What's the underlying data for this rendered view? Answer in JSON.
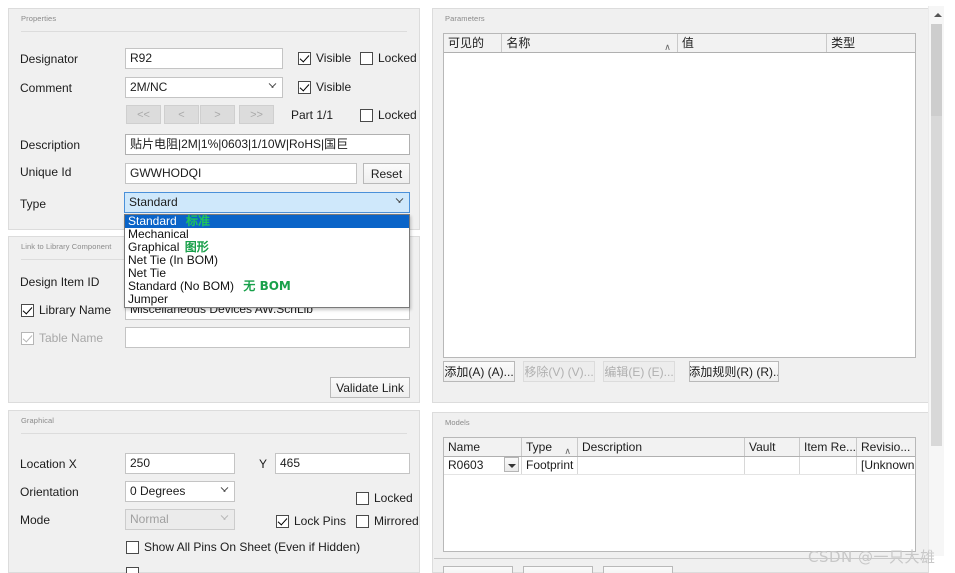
{
  "panels": {
    "properties": {
      "title": "Properties"
    },
    "link_library": {
      "title": "Link to Library Component"
    },
    "graphical": {
      "title": "Graphical"
    },
    "parameters": {
      "title": "Parameters"
    },
    "models": {
      "title": "Models"
    }
  },
  "properties": {
    "designator": {
      "label": "Designator",
      "value": "R92",
      "visible_label": "Visible",
      "locked_label": "Locked"
    },
    "comment": {
      "label": "Comment",
      "value": "2M/NC",
      "visible_label": "Visible"
    },
    "part_nav": {
      "first_label": "<<",
      "prev_label": "<",
      "next_label": ">",
      "last_label": ">>",
      "part_label": "Part 1/1",
      "locked_label": "Locked"
    },
    "description": {
      "label": "Description",
      "value": "贴片电阻|2M|1%|0603|1/10W|RoHS|国巨"
    },
    "unique_id": {
      "label": "Unique Id",
      "value": "GWWHODQI",
      "reset_label": "Reset"
    },
    "type": {
      "label": "Type",
      "value": "Standard",
      "options": [
        {
          "label": "Standard",
          "note": "标准",
          "selected": true
        },
        {
          "label": "Mechanical",
          "note": "",
          "selected": false
        },
        {
          "label": "Graphical",
          "note": "图形",
          "selected": false
        },
        {
          "label": "Net Tie (In BOM)",
          "note": "",
          "selected": false
        },
        {
          "label": "Net Tie",
          "note": "",
          "selected": false
        },
        {
          "label": "Standard (No BOM)",
          "note": "无 BOM",
          "selected": false
        },
        {
          "label": "Jumper",
          "note": "",
          "selected": false
        }
      ]
    }
  },
  "link_library": {
    "design_item_id": {
      "label": "Design Item ID",
      "value": ""
    },
    "library_name": {
      "label": "Library Name",
      "value": "Miscellaneous Devices AW.SchLib"
    },
    "table_name": {
      "label": "Table Name",
      "value": ""
    },
    "validate_link_label": "Validate Link"
  },
  "graphical": {
    "location": {
      "label_x": "Location  X",
      "value_x": "250",
      "label_y": "Y",
      "value_y": "465"
    },
    "orientation": {
      "label": "Orientation",
      "value": "0 Degrees"
    },
    "mode": {
      "label": "Mode",
      "value": "Normal"
    },
    "locked_label": "Locked",
    "lock_pins_label": "Lock Pins",
    "mirrored_label": "Mirrored",
    "show_all_pins_label": "Show All Pins On Sheet (Even if Hidden)"
  },
  "parameters": {
    "columns": [
      "可见的",
      "名称",
      "值",
      "类型"
    ],
    "sort_column_index": 1,
    "sort_mark": "∧",
    "rows": [],
    "buttons": [
      {
        "label": "添加(A) (A)...",
        "enabled": true
      },
      {
        "label": "移除(V) (V)...",
        "enabled": false
      },
      {
        "label": "编辑(E) (E)...",
        "enabled": false
      },
      {
        "label": "添加规则(R) (R)..",
        "enabled": true
      }
    ]
  },
  "models": {
    "columns": [
      "Name",
      "Type",
      "Description",
      "Vault",
      "Item Re...",
      "Revisio..."
    ],
    "sort_column_index": 1,
    "sort_mark": "∧",
    "rows": [
      {
        "name": "R0603",
        "type": "Footprint",
        "description": "",
        "vault": "",
        "item_rev": "",
        "revision": "[Unknown"
      }
    ]
  },
  "watermark": "CSDN @一只大雄",
  "colors": {
    "panel_bg": "#f0f0f0",
    "accent_selection": "#0a64c8",
    "combo_open_bg": "#cfe8fb",
    "annotation_green": "#18a04a"
  }
}
